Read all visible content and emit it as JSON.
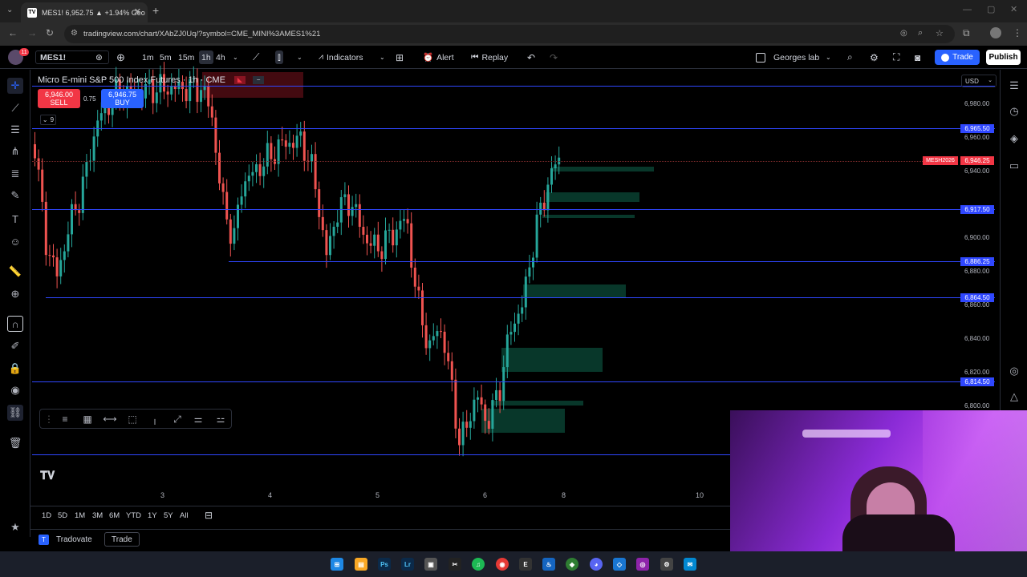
{
  "browser": {
    "tab_title": "MES1! 6,952.75 ▲ +1.94% Geo",
    "url": "tradingview.com/chart/XAbZJ0Uq/?symbol=CME_MINI%3AMES1%21"
  },
  "toolbar": {
    "badge_count": "11",
    "symbol": "MES1!",
    "intervals": [
      "1m",
      "5m",
      "15m",
      "1h",
      "4h"
    ],
    "active_interval": "1h",
    "indicators_label": "Indicators",
    "alert_label": "Alert",
    "replay_label": "Replay",
    "layout_name": "Georges lab",
    "trade_label": "Trade",
    "publish_label": "Publish"
  },
  "legend": {
    "title": "Micro E-mini S&P 500 Index Futures · 1h · CME",
    "sell_price": "6,946.00",
    "sell_label": "SELL",
    "buy_price": "6,946.75",
    "buy_label": "BUY",
    "spread": "0.75",
    "collapsed_count": "9"
  },
  "price_axis": {
    "currency": "USD",
    "ticks": [
      "6,980.00",
      "6,960.00",
      "6,940.00",
      "6,900.00",
      "6,880.00",
      "6,860.00",
      "6,840.00",
      "6,820.00",
      "6,800.00"
    ],
    "level_labels": [
      "6,965.50",
      "6,917.50",
      "6,886.25",
      "6,864.50",
      "6,814.50"
    ],
    "current_symbol": "MESH2026",
    "current_price": "6,946.25"
  },
  "time_axis": {
    "ticks": [
      "3",
      "4",
      "5",
      "6",
      "8",
      "10"
    ]
  },
  "range_bar": {
    "ranges": [
      "1D",
      "5D",
      "1M",
      "3M",
      "6M",
      "YTD",
      "1Y",
      "5Y",
      "All"
    ]
  },
  "bottom_panel": {
    "broker": "Tradovate",
    "trade_tab": "Trade"
  },
  "colors": {
    "up": "#26a69a",
    "down": "#ef5350",
    "level_line": "#2f47ff",
    "zone": "#0b4a38"
  },
  "chart_data": {
    "type": "candlestick",
    "symbol": "MES1!",
    "interval": "1h",
    "x_ticks": [
      "3",
      "4",
      "5",
      "6",
      "8",
      "10"
    ],
    "horizontal_levels": [
      6965.5,
      6917.5,
      6886.25,
      6864.5,
      6814.5
    ],
    "current_price": 6946.25,
    "ylim": [
      6790,
      6995
    ]
  }
}
